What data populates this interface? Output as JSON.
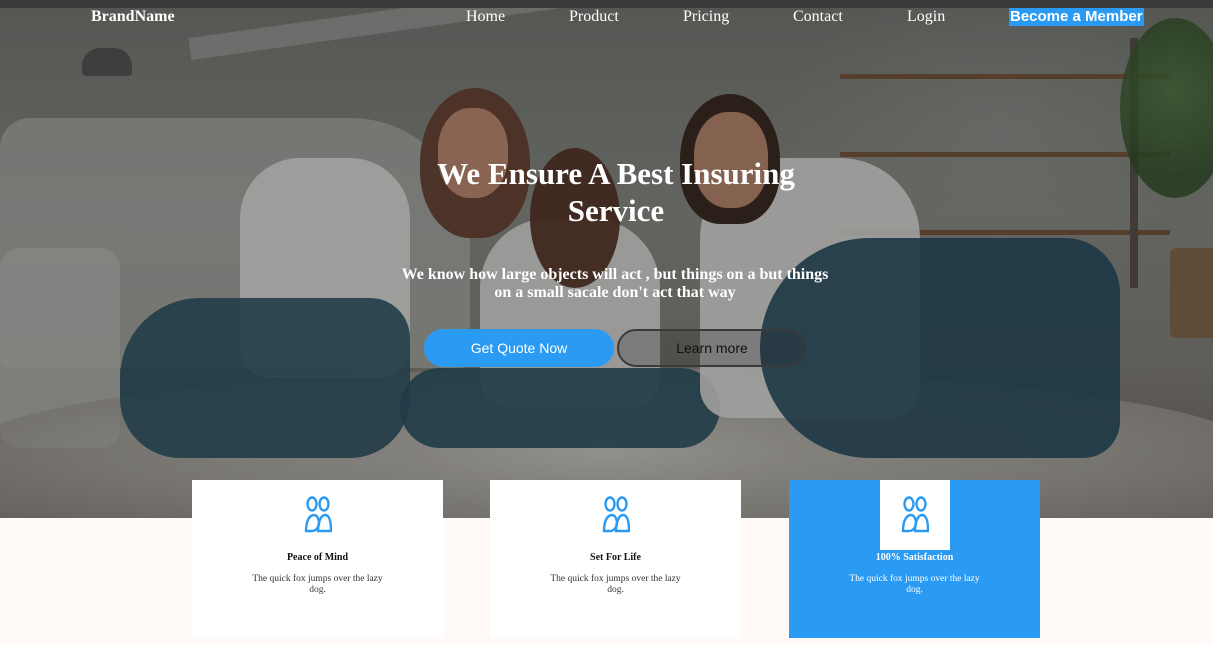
{
  "nav": {
    "brand": "BrandName",
    "links": [
      "Home",
      "Product",
      "Pricing",
      "Contact",
      "Login"
    ],
    "cta": "Become a Member"
  },
  "hero": {
    "title": "We Ensure A Best Insuring Service",
    "subtitle": "We know how large objects will act , but things on a but things on a small sacale don't act that way",
    "primary_button": "Get Quote Now",
    "secondary_button": "Learn more"
  },
  "features": [
    {
      "title": "Peace of Mind",
      "text": "The quick fox jumps over the lazy dog.",
      "icon": "users-icon",
      "highlighted": false
    },
    {
      "title": "Set For Life",
      "text": "The quick fox jumps over the lazy dog.",
      "icon": "users-icon",
      "highlighted": false
    },
    {
      "title": "100% Satisfaction",
      "text": "The quick fox jumps over the lazy dog.",
      "icon": "users-icon",
      "highlighted": true
    }
  ],
  "colors": {
    "accent": "#2b9af2",
    "page_background": "#fffaf8"
  }
}
